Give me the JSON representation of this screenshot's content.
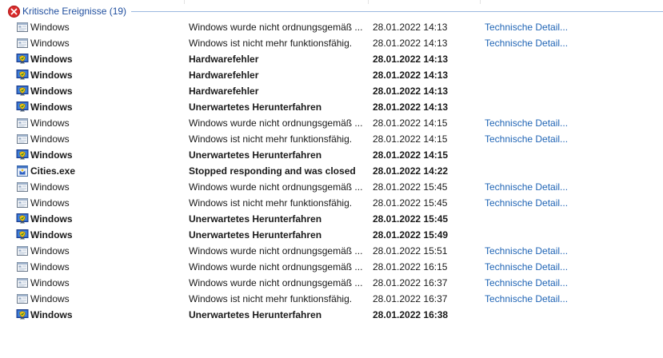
{
  "group": {
    "title": "Kritische Ereignisse (19)",
    "icon": "error-circle-icon"
  },
  "rows": [
    {
      "source": "Windows",
      "summary": "Windows wurde nicht ordnungsgemäß ...",
      "date": "28.01.2022 14:13",
      "action": "Technische Detail...",
      "icon": "window-app-icon",
      "bold": false
    },
    {
      "source": "Windows",
      "summary": "Windows ist nicht mehr funktionsfähig.",
      "date": "28.01.2022 14:13",
      "action": "Technische Detail...",
      "icon": "window-app-icon",
      "bold": false
    },
    {
      "source": "Windows",
      "summary": "Hardwarefehler",
      "date": "28.01.2022 14:13",
      "action": "",
      "icon": "shield-monitor-icon",
      "bold": true
    },
    {
      "source": "Windows",
      "summary": "Hardwarefehler",
      "date": "28.01.2022 14:13",
      "action": "",
      "icon": "shield-monitor-icon",
      "bold": true
    },
    {
      "source": "Windows",
      "summary": "Hardwarefehler",
      "date": "28.01.2022 14:13",
      "action": "",
      "icon": "shield-monitor-icon",
      "bold": true
    },
    {
      "source": "Windows",
      "summary": "Unerwartetes Herunterfahren",
      "date": "28.01.2022 14:13",
      "action": "",
      "icon": "shield-monitor-icon",
      "bold": true
    },
    {
      "source": "Windows",
      "summary": "Windows wurde nicht ordnungsgemäß ...",
      "date": "28.01.2022 14:15",
      "action": "Technische Detail...",
      "icon": "window-app-icon",
      "bold": false
    },
    {
      "source": "Windows",
      "summary": "Windows ist nicht mehr funktionsfähig.",
      "date": "28.01.2022 14:15",
      "action": "Technische Detail...",
      "icon": "window-app-icon",
      "bold": false
    },
    {
      "source": "Windows",
      "summary": "Unerwartetes Herunterfahren",
      "date": "28.01.2022 14:15",
      "action": "",
      "icon": "shield-monitor-icon",
      "bold": true
    },
    {
      "source": "Cities.exe",
      "summary": "Stopped responding and was closed",
      "date": "28.01.2022 14:22",
      "action": "",
      "icon": "app-exe-icon",
      "bold": true
    },
    {
      "source": "Windows",
      "summary": "Windows wurde nicht ordnungsgemäß ...",
      "date": "28.01.2022 15:45",
      "action": "Technische Detail...",
      "icon": "window-app-icon",
      "bold": false
    },
    {
      "source": "Windows",
      "summary": "Windows ist nicht mehr funktionsfähig.",
      "date": "28.01.2022 15:45",
      "action": "Technische Detail...",
      "icon": "window-app-icon",
      "bold": false
    },
    {
      "source": "Windows",
      "summary": "Unerwartetes Herunterfahren",
      "date": "28.01.2022 15:45",
      "action": "",
      "icon": "shield-monitor-icon",
      "bold": true
    },
    {
      "source": "Windows",
      "summary": "Unerwartetes Herunterfahren",
      "date": "28.01.2022 15:49",
      "action": "",
      "icon": "shield-monitor-icon",
      "bold": true
    },
    {
      "source": "Windows",
      "summary": "Windows wurde nicht ordnungsgemäß ...",
      "date": "28.01.2022 15:51",
      "action": "Technische Detail...",
      "icon": "window-app-icon",
      "bold": false
    },
    {
      "source": "Windows",
      "summary": "Windows wurde nicht ordnungsgemäß ...",
      "date": "28.01.2022 16:15",
      "action": "Technische Detail...",
      "icon": "window-app-icon",
      "bold": false
    },
    {
      "source": "Windows",
      "summary": "Windows wurde nicht ordnungsgemäß ...",
      "date": "28.01.2022 16:37",
      "action": "Technische Detail...",
      "icon": "window-app-icon",
      "bold": false
    },
    {
      "source": "Windows",
      "summary": "Windows ist nicht mehr funktionsfähig.",
      "date": "28.01.2022 16:37",
      "action": "Technische Detail...",
      "icon": "window-app-icon",
      "bold": false
    },
    {
      "source": "Windows",
      "summary": "Unerwartetes Herunterfahren",
      "date": "28.01.2022 16:38",
      "action": "",
      "icon": "shield-monitor-icon",
      "bold": true
    }
  ],
  "colors": {
    "link": "#1f64b5",
    "group_title": "#1f4e9e",
    "error": "#d92b2b"
  }
}
